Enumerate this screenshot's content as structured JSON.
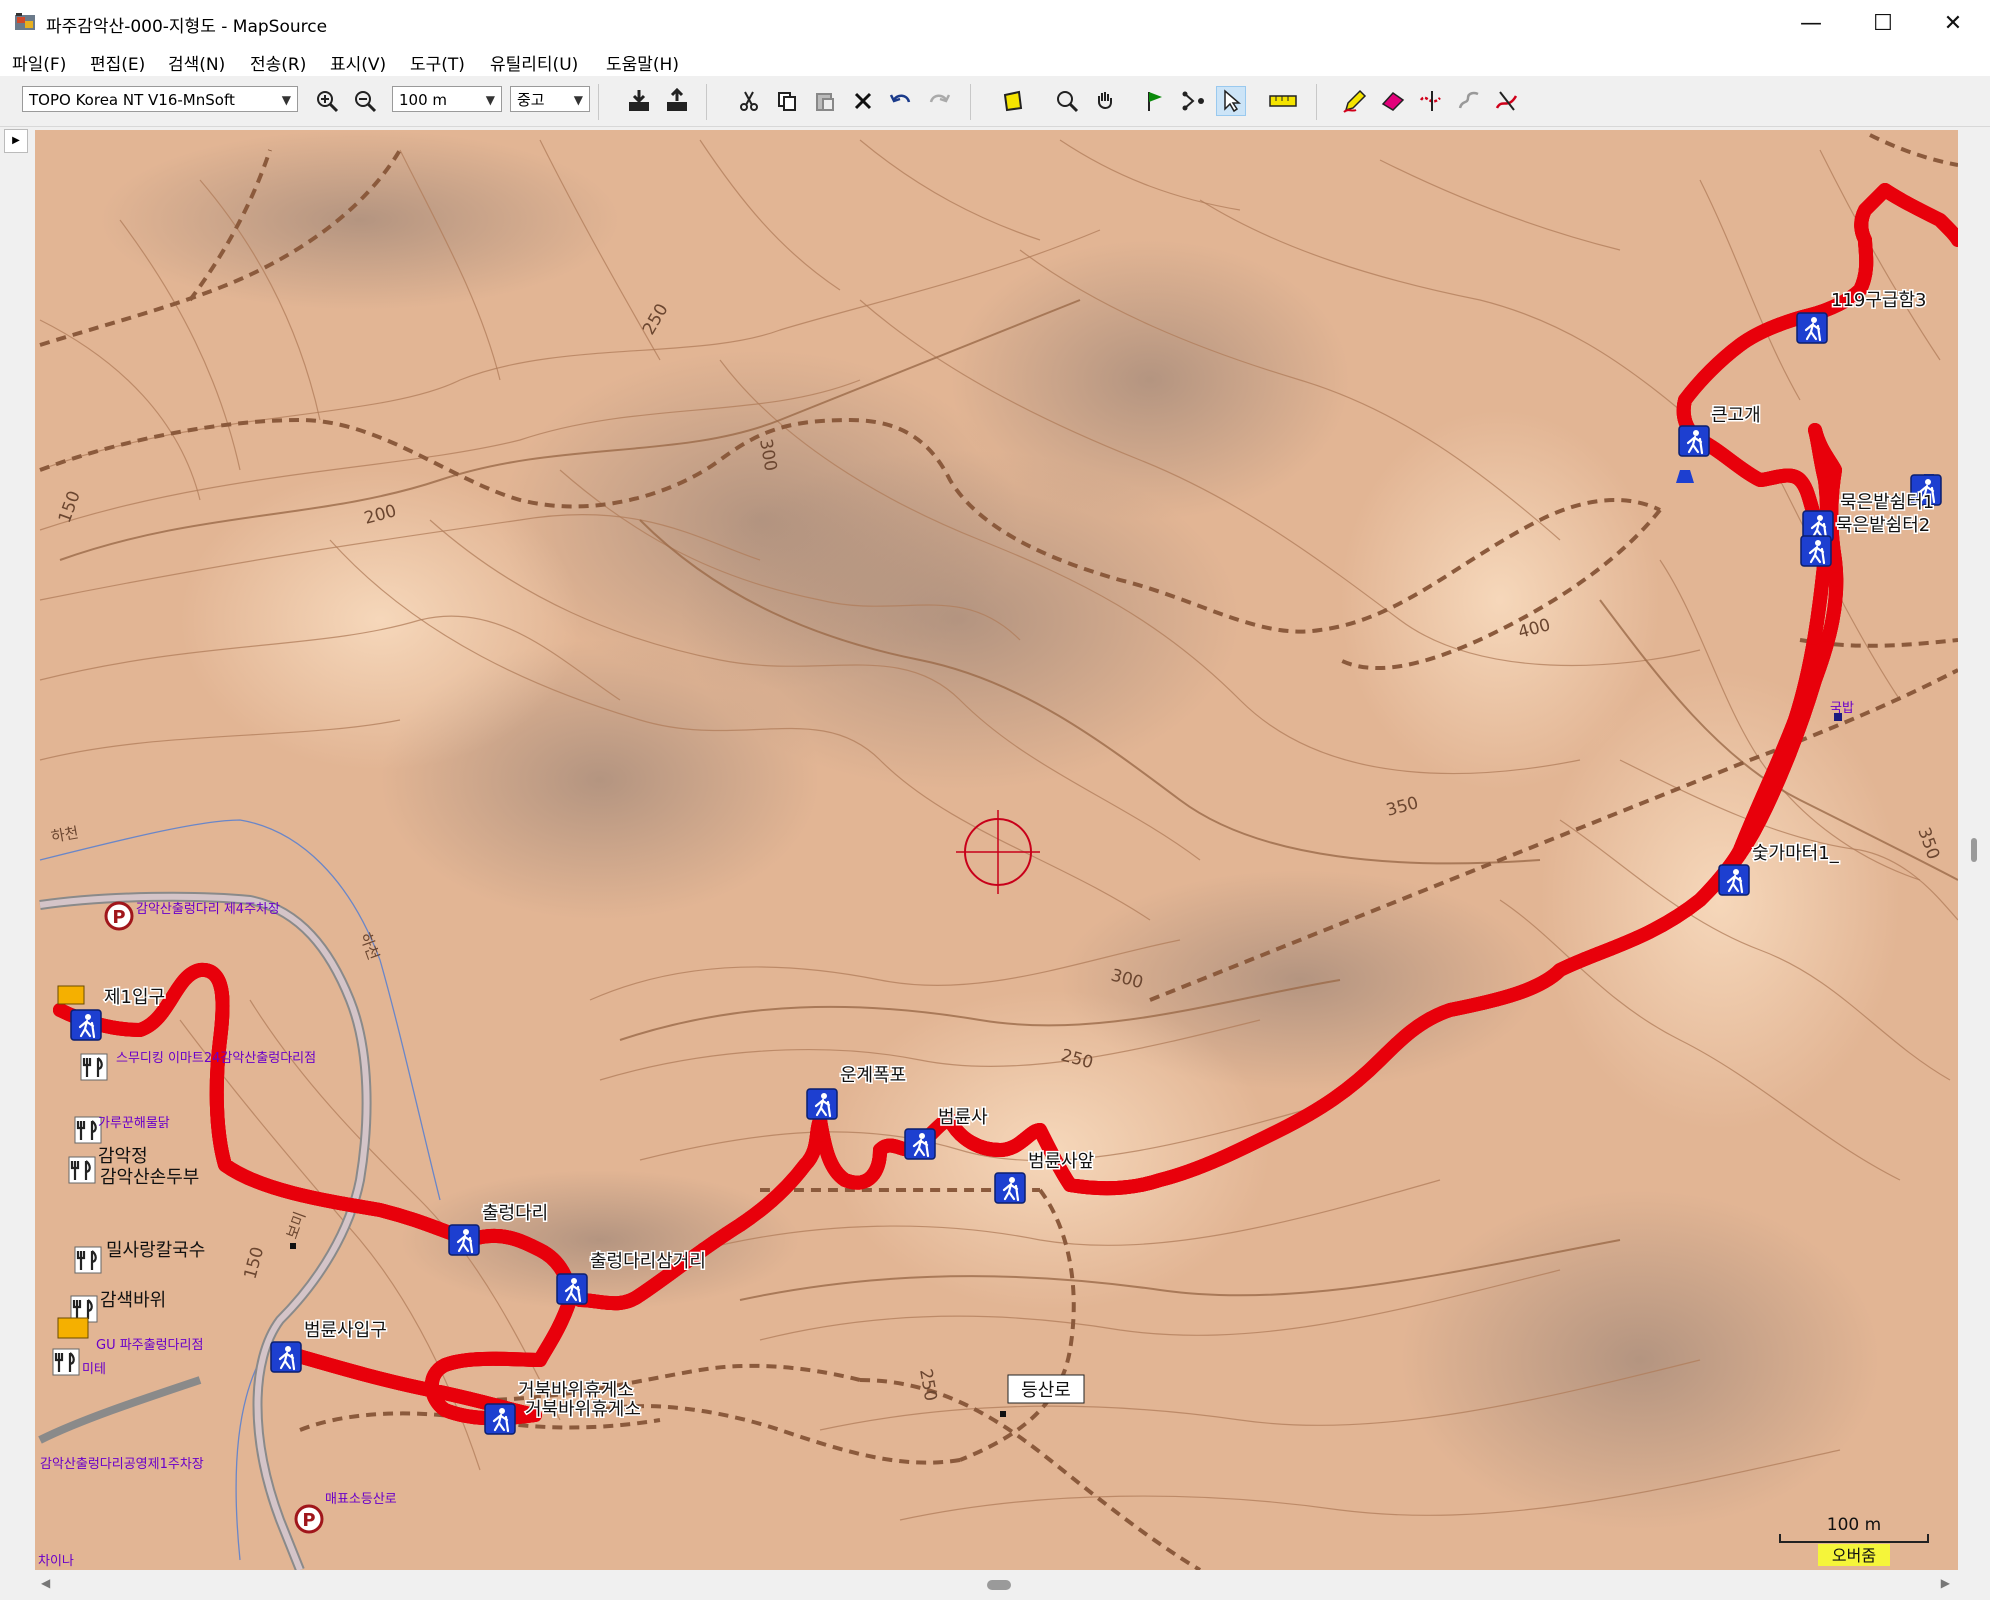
{
  "window": {
    "title": "파주감악산-000-지형도 - MapSource",
    "minimize_glyph": "—",
    "maximize_glyph": "☐",
    "close_glyph": "✕"
  },
  "menu": [
    "파일(F)",
    "편집(E)",
    "검색(N)",
    "전송(R)",
    "표시(V)",
    "도구(T)",
    "유틸리티(U)",
    "도움말(H)"
  ],
  "toolbar": {
    "map_product": "TOPO Korea NT V16-MnSoft",
    "zoom_scale": "100 m",
    "detail_level": "중고",
    "icons": [
      "zoom-in-icon",
      "zoom-out-icon",
      "receive-from-device-icon",
      "send-to-device-icon",
      "cut-icon",
      "copy-icon",
      "paste-icon",
      "delete-icon",
      "undo-icon",
      "redo-icon",
      "map-select-icon",
      "zoom-tool-icon",
      "pan-hand-icon",
      "waypoint-flag-icon",
      "route-tool-icon",
      "selection-pointer-icon",
      "distance-ruler-icon",
      "pencil-track-icon",
      "eraser-icon",
      "divide-track-icon",
      "join-track-icon",
      "track-tool-icon"
    ]
  },
  "map": {
    "waypoints": [
      "119구급함3",
      "큰고개",
      "묵은밭쉼터1",
      "묵은밭쉼터2",
      "숯가마터1_",
      "운계폭포",
      "범륜사",
      "범륜사앞",
      "출렁다리",
      "출렁다리삼거리",
      "범륜사입구",
      "거북바위휴게소",
      "제1입구"
    ],
    "waypoint_shadow_label": "거북바위휴게소",
    "poi_labels": [
      "감악산출렁다리 제4주차장",
      "스무디킹 이마트24감악산출렁다리점",
      "가루꾼해물닭",
      "감악정",
      "감악산손두부",
      "밀사랑칼국수",
      "감색바위",
      "GU 파주출렁다리점",
      "미테",
      "감악산출렁다리공영제1주차장",
      "매표소등산로",
      "등산로",
      "국밥",
      "차이나"
    ],
    "contour_labels": [
      "150",
      "200",
      "250",
      "300",
      "400",
      "350",
      "300",
      "250",
      "250",
      "150",
      "350"
    ],
    "place_labels": [
      "하천",
      "하천",
      "보미"
    ],
    "scale_label": "100 m",
    "overzoom_label": "오버줌",
    "track_color": "#e8000b",
    "trail_color": "#8b5a3c"
  }
}
